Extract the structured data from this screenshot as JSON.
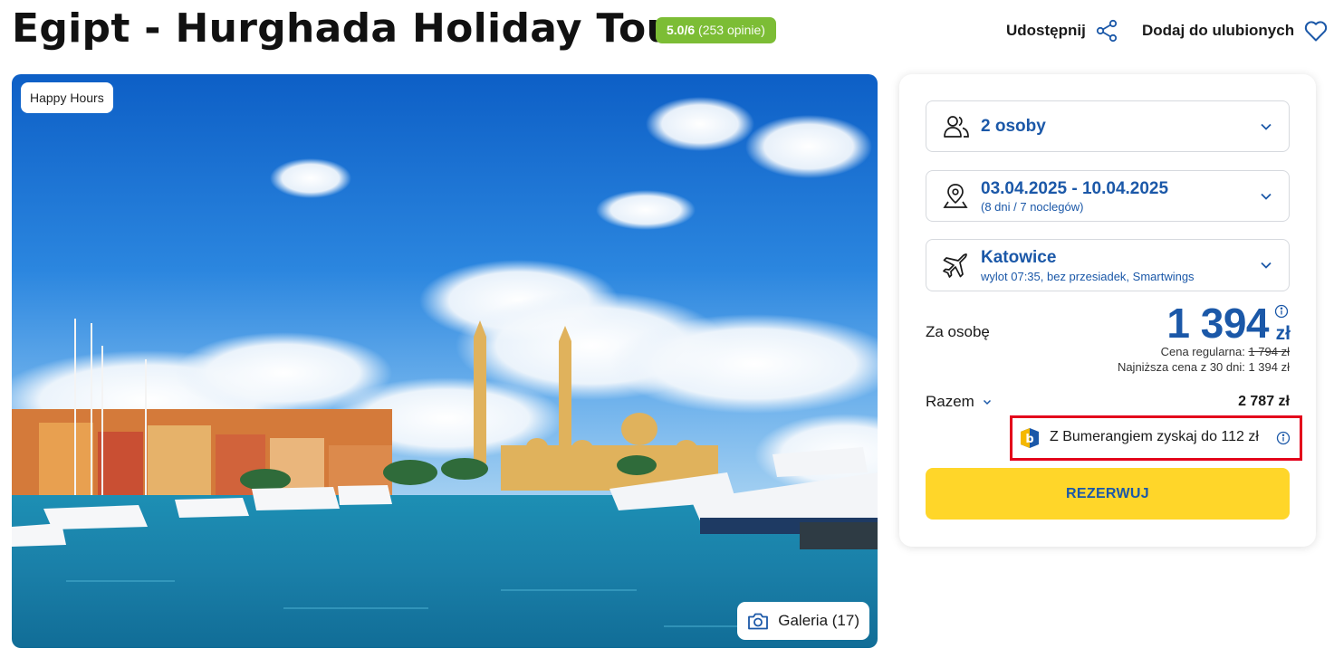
{
  "header": {
    "title": "Egipt - Hurghada Holiday Tour",
    "rating_score": "5.0/6",
    "rating_count": "(253 opinie)",
    "share_label": "Udostępnij",
    "favorites_label": "Dodaj do ulubionych"
  },
  "hero": {
    "tag": "Happy Hours",
    "gallery_label": "Galeria (17)"
  },
  "booking": {
    "persons": {
      "value": "2 osoby",
      "icon": "people-icon"
    },
    "dates": {
      "value": "03.04.2025 - 10.04.2025",
      "sub": "(8 dni / 7 noclegów)",
      "icon": "location-pin-icon"
    },
    "departure": {
      "value": "Katowice",
      "sub": "wylot 07:35, bez przesiadek, Smartwings",
      "icon": "airplane-icon"
    },
    "per_person_label": "Za osobę",
    "price": "1 394",
    "currency": "zł",
    "regular_price_label": "Cena regularna:",
    "regular_price_value": "1 794 zł",
    "lowest_price_text": "Najniższa cena z 30 dni: 1 394 zł",
    "total_label": "Razem",
    "total_value": "2 787 zł",
    "boomerang_text": "Z Bumerangiem zyskaj do 112 zł",
    "reserve_label": "REZERWUJ"
  },
  "colors": {
    "brand_blue": "#1b58a8",
    "rating_green": "#7cbd35",
    "cta_yellow": "#ffd629",
    "highlight_red": "#e3001b"
  }
}
